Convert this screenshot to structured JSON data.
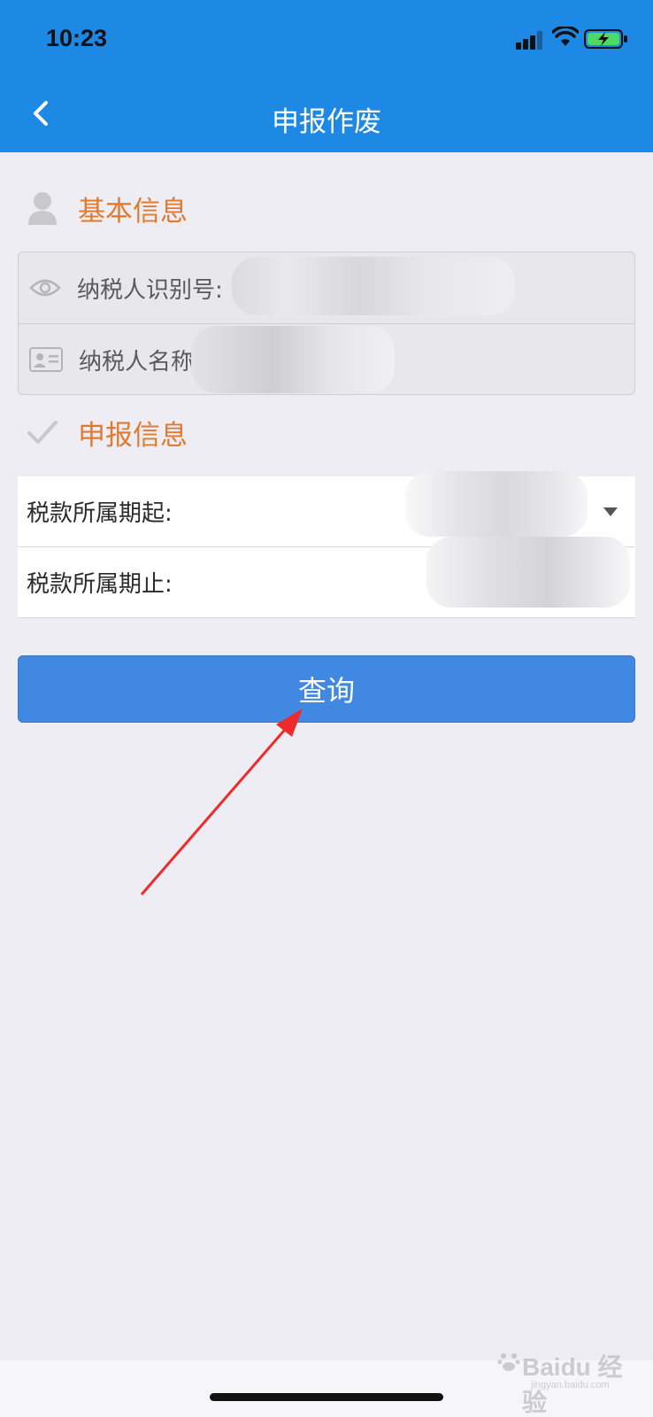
{
  "status_bar": {
    "time": "10:23"
  },
  "header": {
    "title": "申报作废"
  },
  "basic_info": {
    "section_title": "基本信息",
    "taxpayer_id_label": "纳税人识别号:",
    "taxpayer_name_label": "纳税人名称"
  },
  "report_info": {
    "section_title": "申报信息",
    "period_start_label": "税款所属期起:",
    "period_end_label": "税款所属期止:"
  },
  "actions": {
    "query_label": "查询"
  },
  "watermark": {
    "brand": "Baidu 经验",
    "url": "jingyan.baidu.com"
  },
  "colors": {
    "primary": "#1e88e5",
    "button": "#4188e3",
    "section_title": "#e07b2e",
    "annotation_arrow": "#ee2a2a"
  }
}
